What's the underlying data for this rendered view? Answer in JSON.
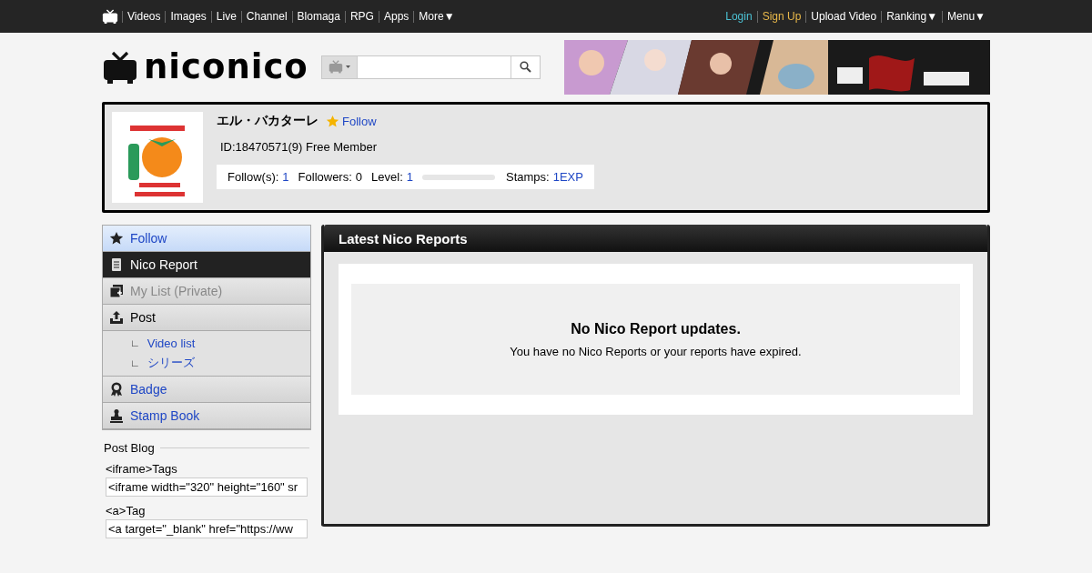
{
  "top_nav": {
    "left": [
      {
        "label": "Videos"
      },
      {
        "label": "Images"
      },
      {
        "label": "Live"
      },
      {
        "label": "Channel"
      },
      {
        "label": "Blomaga"
      },
      {
        "label": "RPG"
      },
      {
        "label": "Apps"
      },
      {
        "label": "More▼"
      }
    ],
    "right": [
      {
        "label": "Login",
        "kind": "login"
      },
      {
        "label": "Sign Up",
        "kind": "signup"
      },
      {
        "label": "Upload Video",
        "kind": "plain"
      },
      {
        "label": "Ranking▼",
        "kind": "plain"
      },
      {
        "label": "Menu▼",
        "kind": "plain"
      }
    ]
  },
  "logo": {
    "text": "niconico"
  },
  "profile": {
    "name": "エル・バカターレ",
    "follow_label": "Follow",
    "id_line": "ID:18470571(9) Free Member",
    "stats": [
      {
        "label": "Follow(s):",
        "value": "1",
        "linked": true
      },
      {
        "label": "Followers:",
        "value": "0",
        "linked": false
      },
      {
        "label": "Level:",
        "value": "1",
        "linked": true,
        "level": 0
      },
      {
        "label": "Stamps:",
        "value": "1EXP",
        "linked": true
      }
    ]
  },
  "sidebar": {
    "items": [
      {
        "label": "Follow",
        "kind": "item",
        "selected": false,
        "highlighted": true,
        "disabled": false
      },
      {
        "label": "Nico Report",
        "kind": "item",
        "selected": true,
        "highlighted": false,
        "disabled": false
      },
      {
        "label": "My List (Private)",
        "kind": "item",
        "selected": false,
        "highlighted": false,
        "disabled": true
      },
      {
        "label": "Post",
        "kind": "item",
        "selected": false,
        "highlighted": false,
        "disabled": false,
        "plain": true,
        "children": [
          {
            "label": "Video list",
            "mark": "∟"
          },
          {
            "label": "シリーズ",
            "mark": "∟"
          }
        ]
      },
      {
        "label": "Badge",
        "kind": "item",
        "selected": false,
        "highlighted": false,
        "disabled": false
      },
      {
        "label": "Stamp Book",
        "kind": "item",
        "selected": false,
        "highlighted": false,
        "disabled": false
      }
    ]
  },
  "post_blog": {
    "title": "Post Blog",
    "fields": [
      {
        "label": "<iframe>Tags",
        "value": "<iframe width=\"320\" height=\"160\" sr"
      },
      {
        "label": "<a>Tag",
        "value": "<a target=\"_blank\" href=\"https://ww"
      }
    ]
  },
  "main": {
    "title": "Latest Nico Reports",
    "empty_title": "No Nico Report updates.",
    "empty_text": "You have no Nico Reports or your reports have expired."
  }
}
